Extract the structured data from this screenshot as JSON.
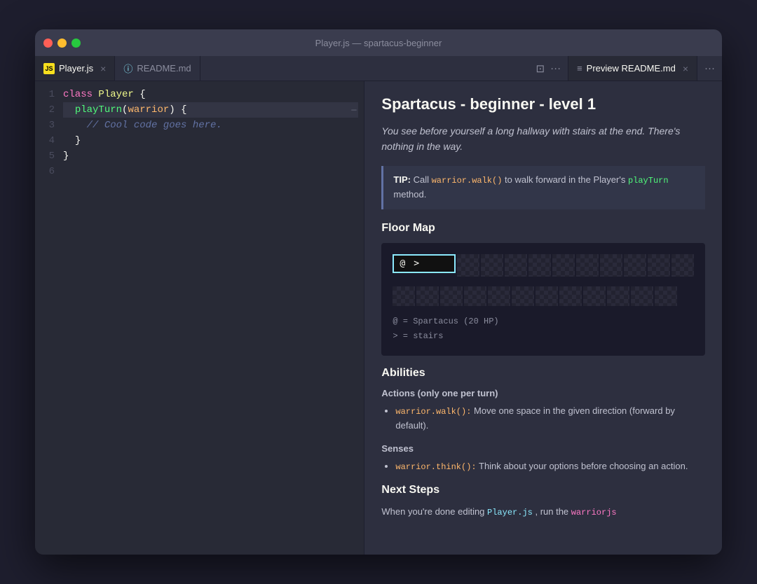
{
  "window": {
    "title": "Player.js — spartacus-beginner"
  },
  "tabs": {
    "left": [
      {
        "id": "player-js",
        "label": "Player.js",
        "icon": "js",
        "active": true,
        "closable": true
      },
      {
        "id": "readme-md",
        "label": "README.md",
        "icon": "info",
        "active": false,
        "closable": false
      }
    ],
    "right": [
      {
        "id": "preview-readme",
        "label": "Preview README.md",
        "icon": "preview",
        "active": true,
        "closable": true
      }
    ]
  },
  "editor": {
    "lines": [
      {
        "num": "1",
        "content": "class Player {"
      },
      {
        "num": "2",
        "content": "  playTurn(warrior) {"
      },
      {
        "num": "3",
        "content": "    // Cool code goes here."
      },
      {
        "num": "4",
        "content": "  }"
      },
      {
        "num": "5",
        "content": "}"
      },
      {
        "num": "6",
        "content": ""
      }
    ]
  },
  "preview": {
    "title": "Spartacus - beginner - level 1",
    "intro": "You see before yourself a long hallway with stairs at the end. There's nothing in the way.",
    "tip": {
      "label": "TIP:",
      "text": " Call ",
      "method1": "warrior.walk()",
      "text2": " to walk forward in the Player's ",
      "method2": "playTurn",
      "text3": " method."
    },
    "floor_map_title": "Floor Map",
    "floor_map": {
      "player_symbol": "@",
      "stairs_symbol": ">",
      "legend_player": "@ = Spartacus (20 HP)",
      "legend_stairs": "> = stairs"
    },
    "abilities_title": "Abilities",
    "actions_label": "Actions (only one per turn)",
    "actions": [
      {
        "method": "warrior.walk():",
        "description": " Move one space in the given direction (forward by default)."
      }
    ],
    "senses_label": "Senses",
    "senses": [
      {
        "method": "warrior.think():",
        "description": " Think about your options before choosing an action."
      }
    ],
    "next_steps_title": "Next Steps",
    "next_steps_text": "When you're done editing ",
    "next_steps_file": "Player.js",
    "next_steps_text2": ", run the ",
    "next_steps_cmd": "warriorjs"
  }
}
